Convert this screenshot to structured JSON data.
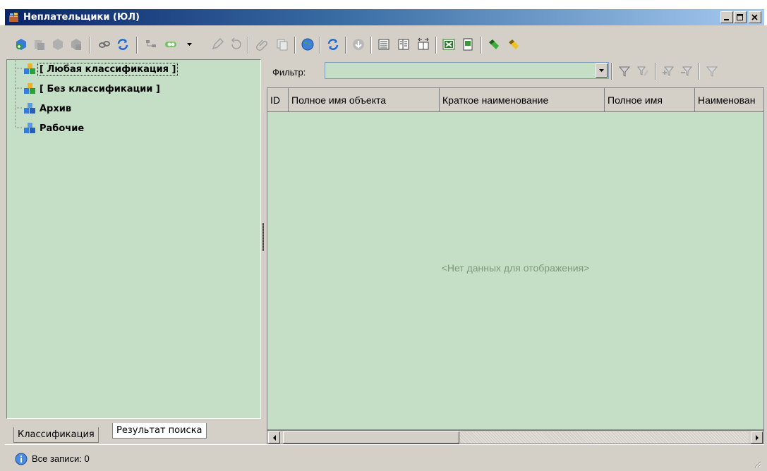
{
  "window": {
    "title": "Неплательщики (ЮЛ)"
  },
  "tree": {
    "items": [
      {
        "label": "[ Любая классификация ]",
        "icon": "classification-icon"
      },
      {
        "label": "[ Без классификации ]",
        "icon": "classification-icon"
      },
      {
        "label": "Архив",
        "icon": "folder-cubes-icon"
      },
      {
        "label": "Рабочие",
        "icon": "folder-cubes-icon"
      }
    ]
  },
  "tabs": {
    "classification": "Классификация",
    "search_result": "Результат поиска"
  },
  "filter": {
    "label": "Фильтр:",
    "value": ""
  },
  "grid": {
    "columns": [
      "ID",
      "Полное имя объекта",
      "Краткое наименование",
      "Полное имя",
      "Наименован"
    ],
    "empty_text": "<Нет данных для отображения>"
  },
  "status": {
    "text": "Все записи: 0"
  },
  "colors": {
    "panel_bg": "#c5dfc6",
    "chrome_bg": "#d4d0c8",
    "title_gradient_start": "#0a246a",
    "title_gradient_end": "#a6caf0"
  }
}
